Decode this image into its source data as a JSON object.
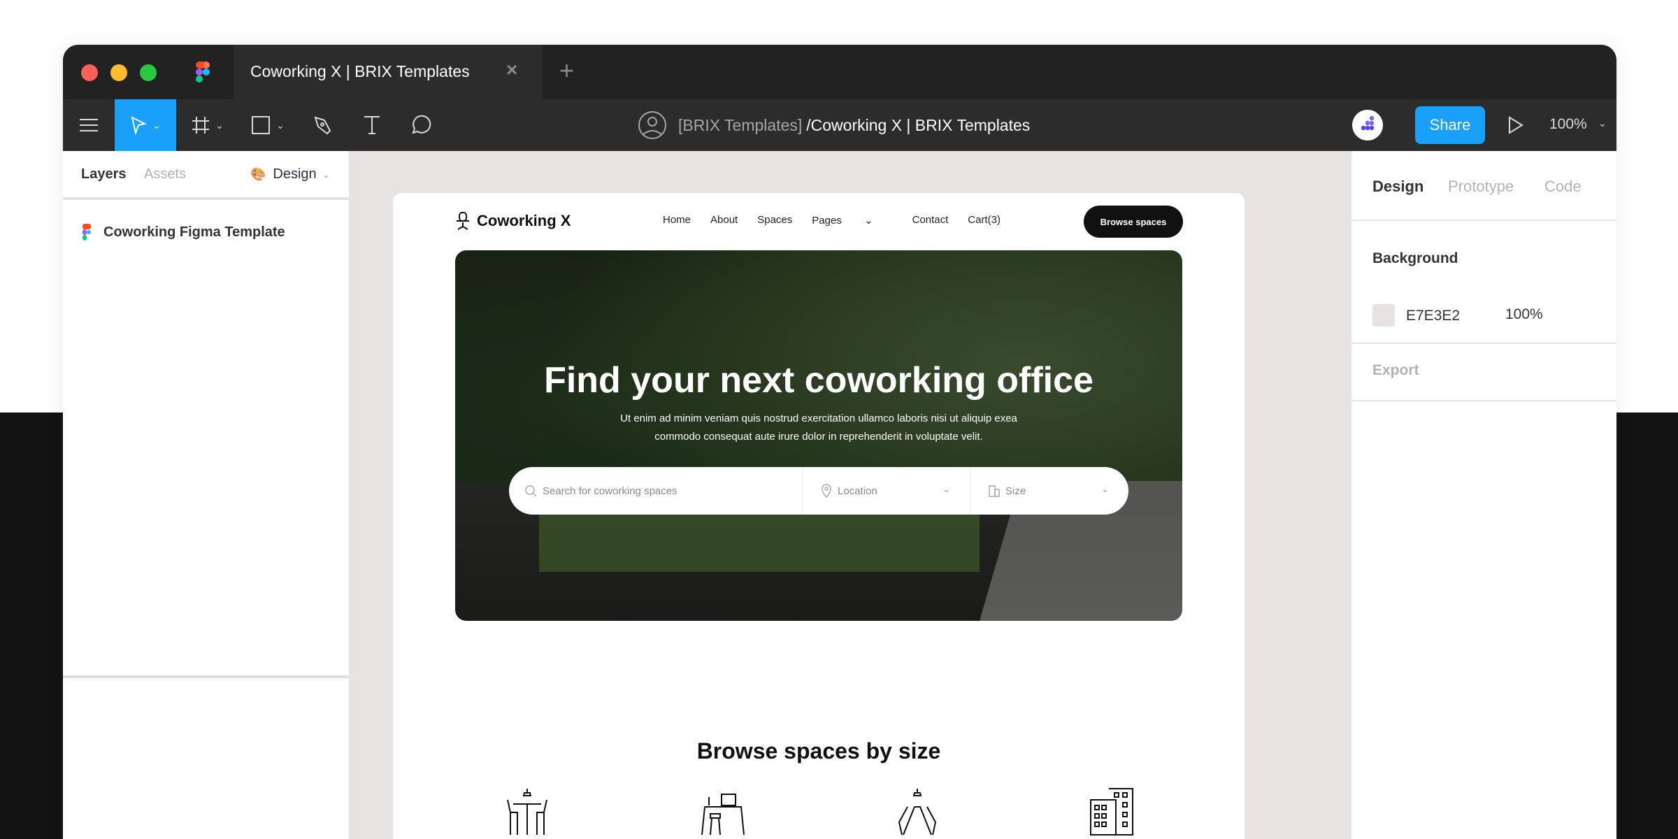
{
  "window": {
    "tab_title": "Coworking X | BRIX Templates",
    "tab_close": "×",
    "tab_add": "+"
  },
  "toolbar": {
    "tools": [
      {
        "name": "main-menu",
        "icon": "hamburger-icon"
      },
      {
        "name": "move-tool",
        "icon": "cursor-icon",
        "active": true
      },
      {
        "name": "frame-tool",
        "icon": "frame-icon"
      },
      {
        "name": "shape-tool",
        "icon": "rectangle-icon"
      },
      {
        "name": "pen-tool",
        "icon": "pen-icon"
      },
      {
        "name": "text-tool",
        "icon": "text-icon"
      },
      {
        "name": "comment-tool",
        "icon": "comment-icon"
      }
    ],
    "breadcrumb_team": "[BRIX Templates]",
    "breadcrumb_file": "/Coworking X | BRIX Templates",
    "share_label": "Share",
    "zoom_level": "100%",
    "accent_color": "#18a0fb"
  },
  "left_panel": {
    "tabs": {
      "layers": "Layers",
      "assets": "Assets",
      "page": "Design"
    },
    "layers": [
      {
        "label": "Coworking Figma Template",
        "icon": "figma-icon"
      }
    ]
  },
  "canvas": {
    "site": {
      "logo": "Coworking X",
      "nav": [
        "Home",
        "About",
        "Spaces",
        "Pages",
        "Contact",
        "Cart(3)"
      ],
      "cta": "Browse spaces",
      "hero_title": "Find your next coworking office",
      "hero_subtitle_line1": "Ut enim ad minim veniam quis nostrud exercitation ullamco laboris nisi ut aliquip exea",
      "hero_subtitle_line2": "commodo consequat aute irure dolor in reprehenderit in voluptate velit.",
      "search_placeholder": "Search for coworking spaces",
      "location_label": "Location",
      "size_label": "Size",
      "section_title": "Browse spaces by size",
      "size_icons": [
        "table-icon",
        "desk-icon",
        "meeting-icon",
        "building-icon"
      ]
    }
  },
  "right_panel": {
    "tabs": {
      "design": "Design",
      "prototype": "Prototype",
      "code": "Code"
    },
    "background_title": "Background",
    "background_hex": "E7E3E2",
    "background_opacity": "100%",
    "export_title": "Export",
    "export_add": "+"
  }
}
